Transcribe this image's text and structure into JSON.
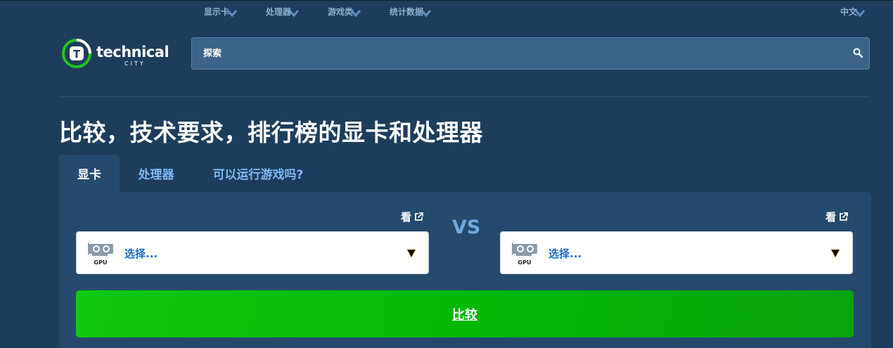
{
  "nav": {
    "items": [
      {
        "label": "显示卡",
        "icon": "chevron-down-icon"
      },
      {
        "label": "处理器",
        "icon": "chevron-down-icon"
      },
      {
        "label": "游戏类",
        "icon": "chevron-down-icon"
      },
      {
        "label": "统计数据",
        "icon": "chevron-down-icon"
      }
    ],
    "language": "中文"
  },
  "logo": {
    "name": "technical",
    "sub": "CITY",
    "mark": "T"
  },
  "search": {
    "placeholder": "探索",
    "icon": "search-icon"
  },
  "page_title": "比较，技术要求，排行榜的显卡和处理器",
  "tabs": [
    {
      "label": "显卡",
      "active": true
    },
    {
      "label": "处理器",
      "active": false
    },
    {
      "label": "可以运行游戏吗?",
      "active": false
    }
  ],
  "compare": {
    "view_label": "看",
    "vs_label": "VS",
    "left_select": {
      "value": "选择...",
      "icon_label": "GPU"
    },
    "right_select": {
      "value": "选择...",
      "icon_label": "GPU"
    },
    "button_label": "比较"
  },
  "colors": {
    "background": "#1e3d5c",
    "panel": "#264a6d",
    "accent_link": "#7fb8f2",
    "button_green": "#03b505",
    "logo_green": "#22c322"
  }
}
